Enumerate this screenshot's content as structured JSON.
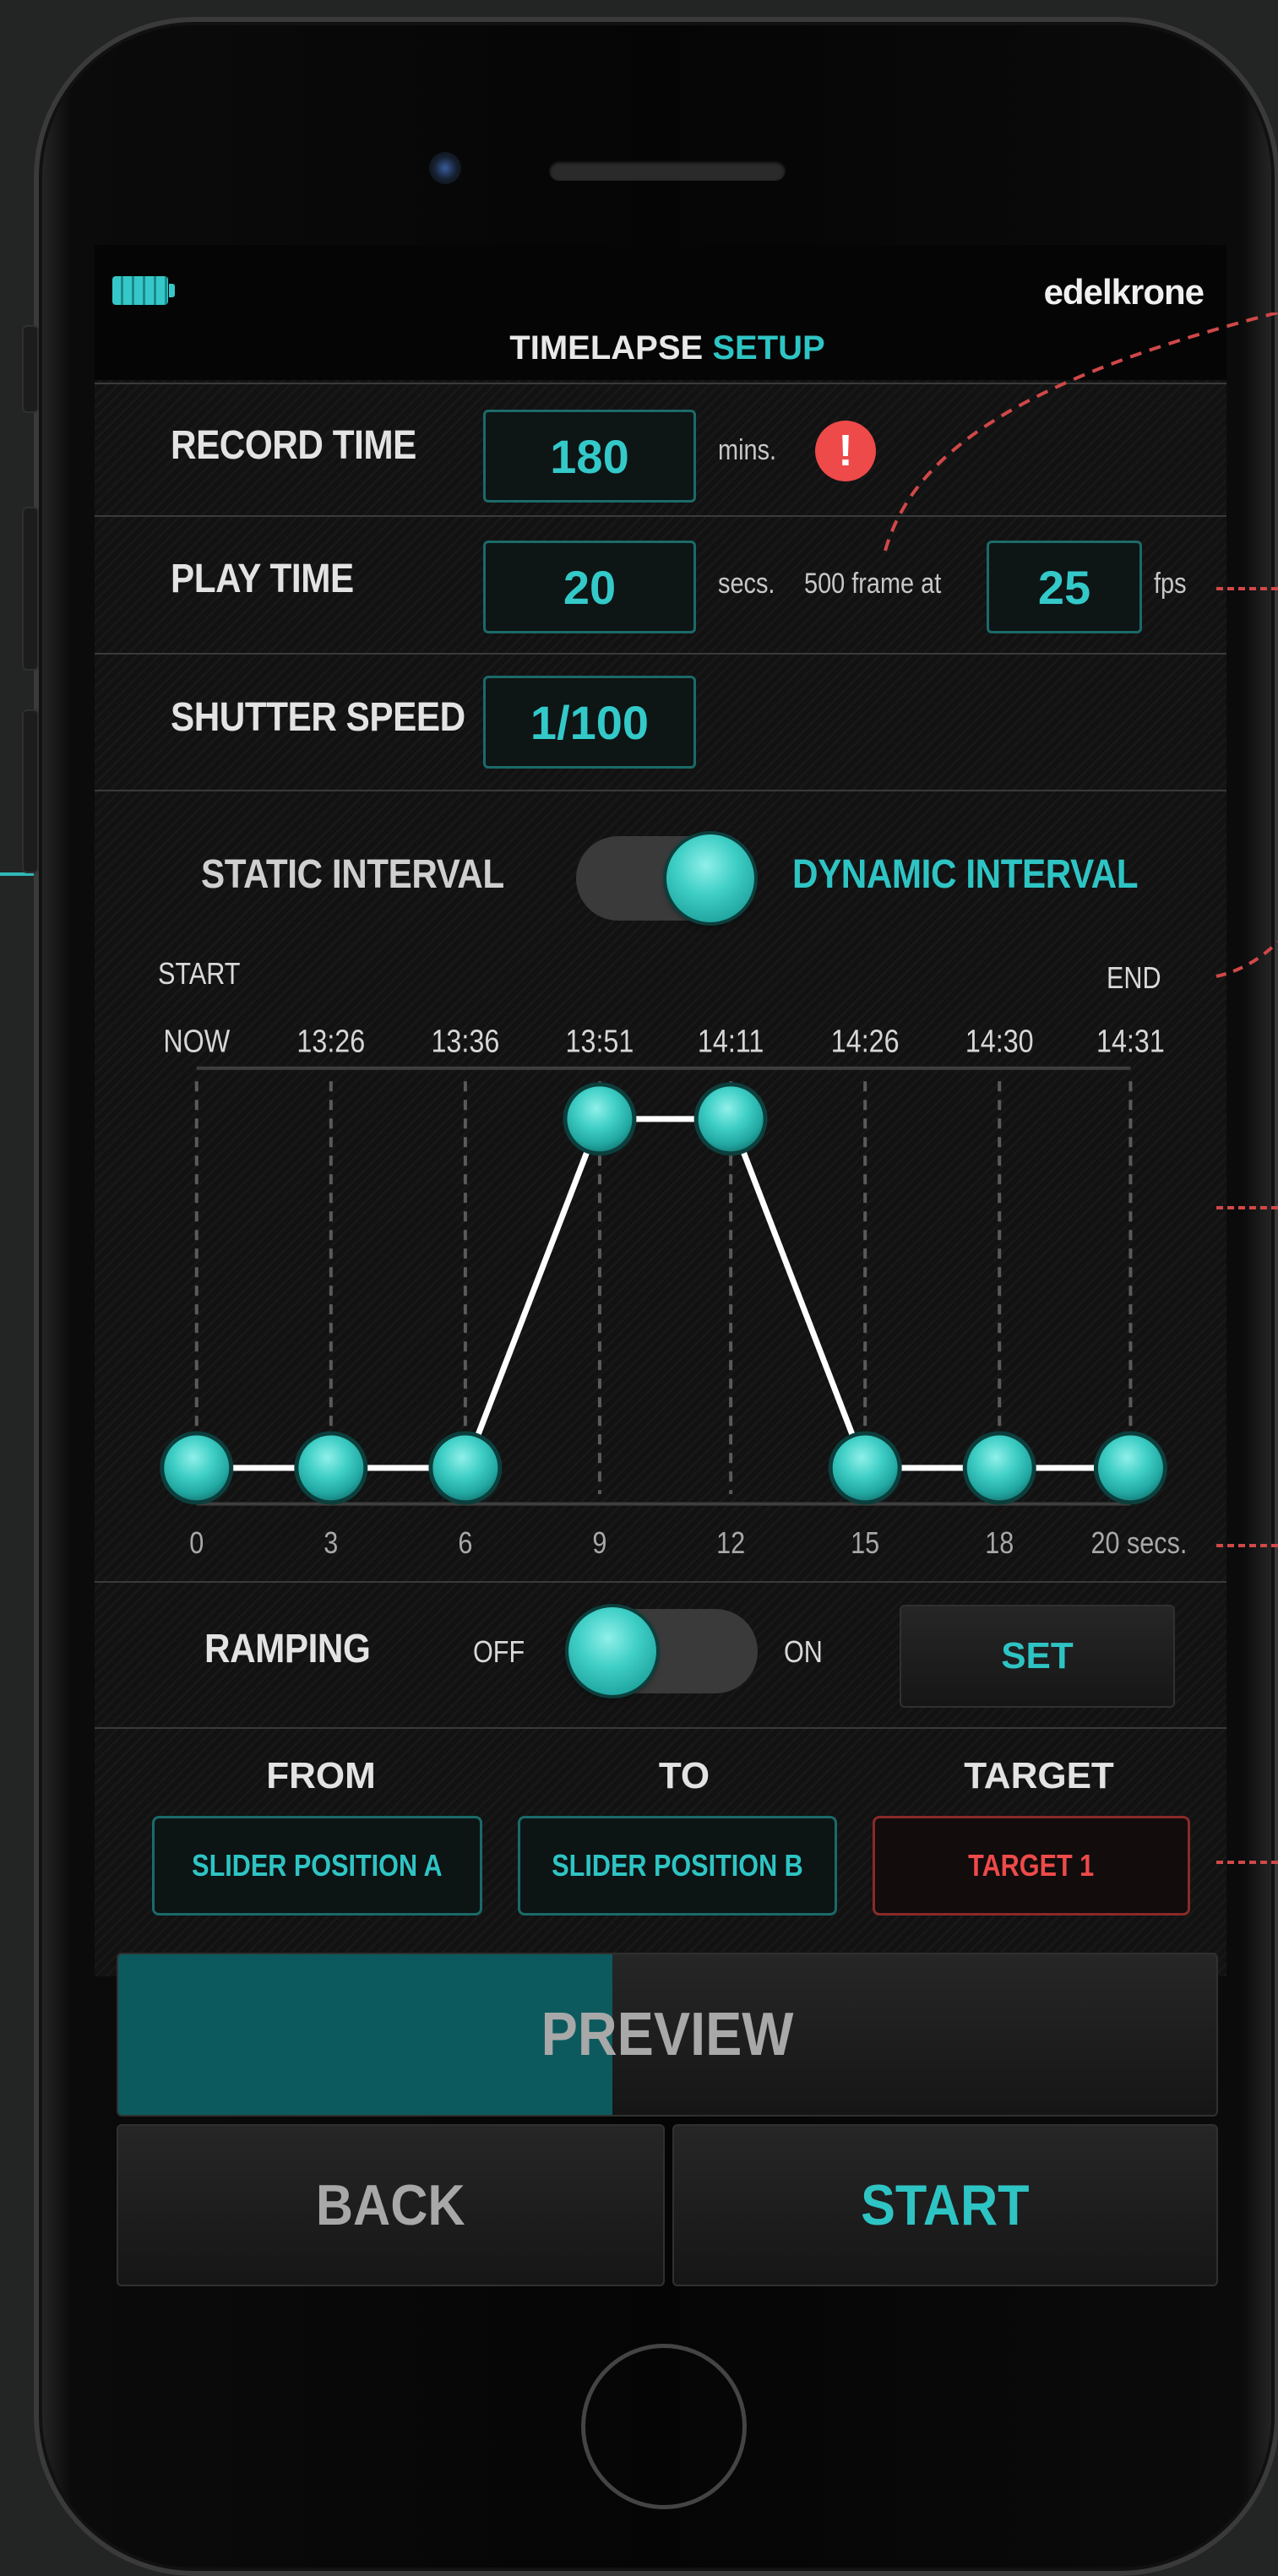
{
  "status": {
    "battery_icon": "battery-icon",
    "brand": "edelkrone"
  },
  "header": {
    "title_part1": "TIMELAPSE",
    "title_part2": "SETUP"
  },
  "settings": {
    "record_time": {
      "label": "RECORD TIME",
      "value": "180",
      "unit": "mins.",
      "alert_icon": "!"
    },
    "play_time": {
      "label": "PLAY TIME",
      "value": "20",
      "unit": "secs.",
      "frames_text": "500 frame at",
      "fps_value": "25",
      "fps_unit": "fps"
    },
    "shutter_speed": {
      "label": "SHUTTER SPEED",
      "value": "1/100"
    }
  },
  "interval": {
    "static_label": "STATIC INTERVAL",
    "dynamic_label": "DYNAMIC INTERVAL",
    "selected": "dynamic"
  },
  "chart_data": {
    "type": "line",
    "start_label": "START",
    "end_label": "END",
    "clock_labels": [
      "NOW",
      "13:26",
      "13:36",
      "13:51",
      "14:11",
      "14:26",
      "14:30",
      "14:31"
    ],
    "x": [
      0,
      3,
      6,
      9,
      12,
      15,
      18,
      20
    ],
    "x_tick_labels": [
      "0",
      "3",
      "6",
      "9",
      "12",
      "15",
      "18",
      "20 secs."
    ],
    "values": [
      0,
      0,
      0,
      1,
      1,
      0,
      0,
      0
    ],
    "ylim": [
      0,
      1
    ],
    "grid": "vertical dashed",
    "color": "#2fc4c4"
  },
  "ramping": {
    "label": "RAMPING",
    "off_label": "OFF",
    "on_label": "ON",
    "state": "off",
    "set_label": "SET"
  },
  "targets": {
    "from_label": "FROM",
    "to_label": "TO",
    "target_label": "TARGET",
    "from_value": "SLIDER POSITION A",
    "to_value": "SLIDER POSITION B",
    "target_value": "TARGET 1"
  },
  "actions": {
    "preview_label": "PREVIEW",
    "preview_progress": 0.45,
    "back_label": "BACK",
    "start_label": "START"
  },
  "colors": {
    "accent": "#2fc4c4",
    "alert": "#ee4a4a",
    "annotation": "#d04848"
  }
}
